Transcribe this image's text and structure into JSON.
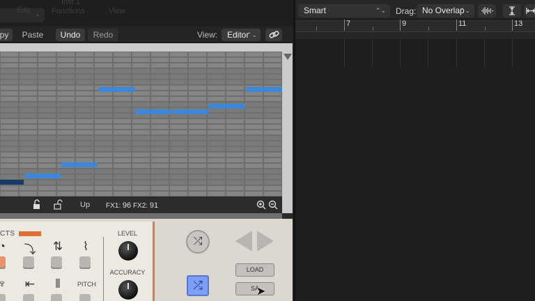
{
  "plugin": {
    "title_ghost": "Inst 1",
    "ghost_items": [
      "Edit",
      "Functions",
      "View"
    ],
    "toolbar": {
      "copy": "py",
      "paste": "Paste",
      "undo": "Undo",
      "redo": "Redo",
      "view_label": "View:",
      "view_value": "Editor"
    },
    "grid_footer": {
      "direction": "Up",
      "fx1_label": "FX1:",
      "fx1_value": "96",
      "fx2_label": "FX2:",
      "fx2_value": "91"
    },
    "effects": {
      "label": "CTS",
      "pitch_label": "PITCH"
    },
    "knobs": {
      "level_label": "LEVEL",
      "accuracy_label": "ACCURACY"
    },
    "buttons": {
      "load": "LOAD",
      "save": "SA"
    },
    "colors": {
      "note_blue": "#3d86d8",
      "shuffle_blue": "#7c9ef5",
      "accent_orange": "#de6f35"
    }
  },
  "arrange": {
    "tool_select": "Smart",
    "drag_label": "Drag:",
    "drag_mode": "No Overlap",
    "ruler_bars": [
      "7",
      "9",
      "11",
      "13"
    ]
  }
}
